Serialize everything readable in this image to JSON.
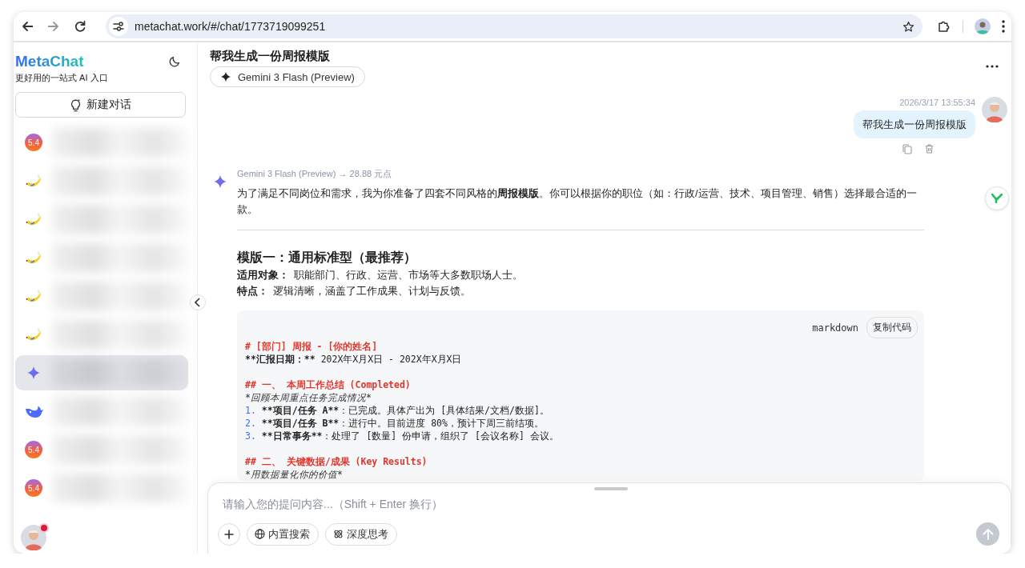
{
  "browser": {
    "url": "metachat.work/#/chat/1773719099251"
  },
  "sidebar": {
    "logo": "MetaChat",
    "tagline": "更好用的一站式 AI 入口",
    "new_chat": "新建对话",
    "items": [
      {
        "kind": "gpt",
        "badge": "5.4",
        "selected": false
      },
      {
        "kind": "banana",
        "selected": false
      },
      {
        "kind": "banana",
        "selected": false
      },
      {
        "kind": "banana",
        "selected": false
      },
      {
        "kind": "banana",
        "selected": false
      },
      {
        "kind": "banana",
        "selected": false
      },
      {
        "kind": "gemini",
        "selected": true
      },
      {
        "kind": "whale",
        "selected": false
      },
      {
        "kind": "gpt",
        "badge": "5.4",
        "selected": false
      },
      {
        "kind": "gpt",
        "badge": "5.4",
        "selected": false
      }
    ]
  },
  "chat": {
    "title": "帮我生成一份周报模版",
    "model": "Gemini 3 Flash (Preview)",
    "user_message": {
      "time": "2026/3/17 13:55:34",
      "text": "帮我生成一份周报模版"
    },
    "reply": {
      "meta": "Gemini 3 Flash (Preview) → 28.88 元点",
      "intro": "为了满足不同岗位和需求，我为你准备了四套不同风格的**周报模版**。你可以根据你的职位（如：行政/运营、技术、项目管理、销售）选择最合适的一款。",
      "heading": "模版一：通用标准型（最推荐）",
      "facts": [
        {
          "label": "适用对象：",
          "text": "职能部门、行政、运营、市场等大多数职场人士。"
        },
        {
          "label": "特点：",
          "text": "逻辑清晰，涵盖了工作成果、计划与反馈。"
        }
      ],
      "code": {
        "language": "markdown",
        "copy": "复制代码",
        "lines": [
          {
            "kind": "heading",
            "text": "# [部门] 周报 - [你的姓名]"
          },
          {
            "kind": "field",
            "strong": "**汇报日期：**",
            "text": " 202X年X月X日 - 202X年X月X日"
          },
          {
            "kind": "blank"
          },
          {
            "kind": "heading",
            "text": "## 一、 本周工作总结 (Completed)"
          },
          {
            "kind": "italic",
            "text": "*回顾本周重点任务完成情况*"
          },
          {
            "kind": "item",
            "number": "1.",
            "strong": "**项目/任务 A**",
            "text": "：已完成。具体产出为 [具体结果/文档/数据]。"
          },
          {
            "kind": "item",
            "number": "2.",
            "strong": "**项目/任务 B**",
            "text": "：进行中。目前进度 80%，预计下周三前结项。"
          },
          {
            "kind": "item",
            "number": "3.",
            "strong": "**日常事务**",
            "text": "：处理了 [数量] 份申请，组织了 [会议名称] 会议。"
          },
          {
            "kind": "blank"
          },
          {
            "kind": "heading",
            "text": "## 二、 关键数据/成果 (Key Results)"
          },
          {
            "kind": "italic",
            "text": "*用数据量化你的价值*"
          }
        ]
      }
    }
  },
  "input": {
    "placeholder": "请输入您的提问内容...（Shift + Enter 换行）",
    "tools": [
      {
        "kind": "search",
        "label": "内置搜索"
      },
      {
        "kind": "think",
        "label": "深度思考"
      }
    ]
  }
}
